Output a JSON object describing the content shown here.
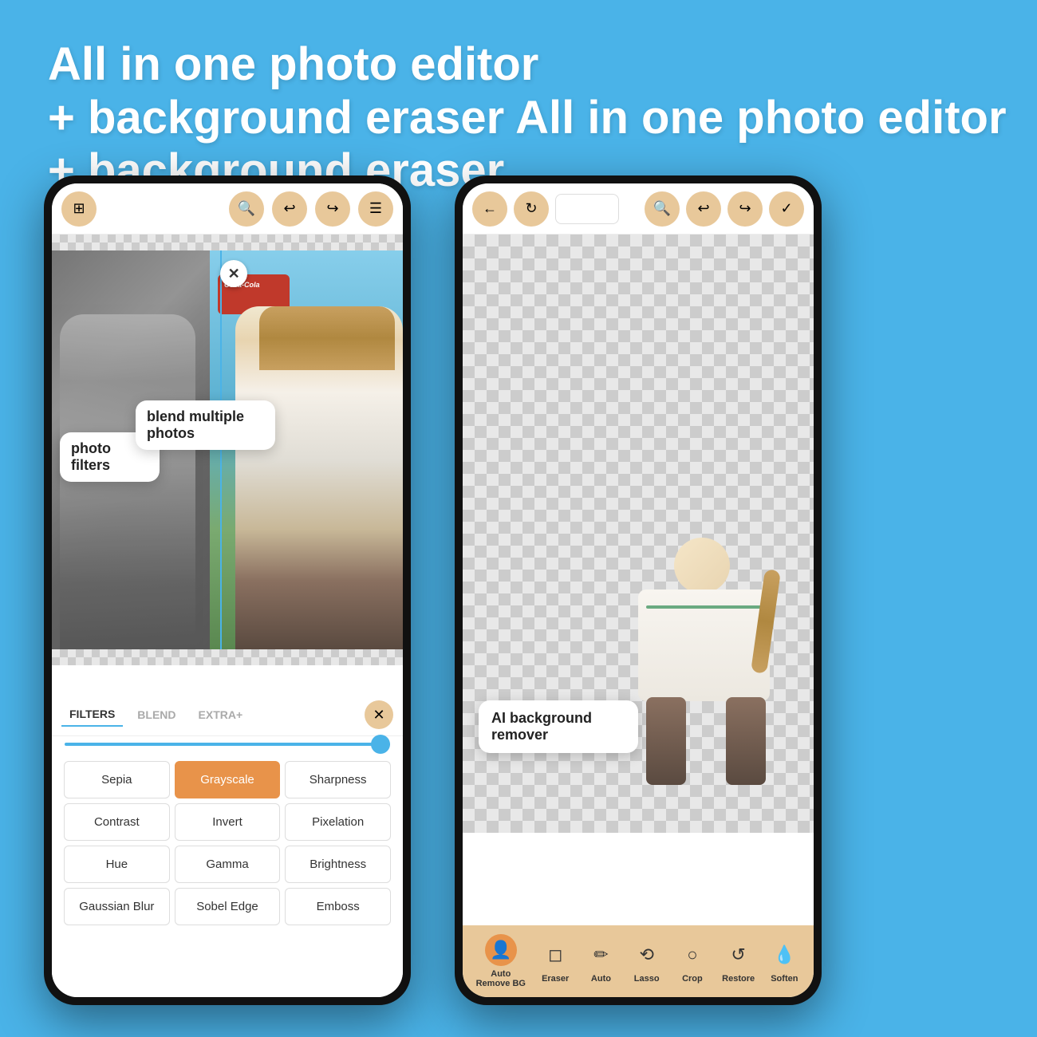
{
  "hero": {
    "title": "All in one photo editor\n+ background eraser"
  },
  "phone_left": {
    "toolbar": {
      "layers_icon": "⊕",
      "search_icon": "🔍",
      "undo_icon": "↩",
      "redo_icon": "↪",
      "menu_icon": "☰"
    },
    "callouts": {
      "filters_label": "photo\nfilters",
      "blend_label": "blend multiple\nphotos"
    },
    "tabs": {
      "filters": "FILTERS",
      "blend": "BLEND",
      "extra": "EXTRA+"
    },
    "close_icon": "×",
    "filters": [
      {
        "label": "Sepia",
        "active": false
      },
      {
        "label": "Grayscale",
        "active": true
      },
      {
        "label": "Sharpness",
        "active": false
      },
      {
        "label": "Contrast",
        "active": false
      },
      {
        "label": "Invert",
        "active": false
      },
      {
        "label": "Pixelation",
        "active": false
      },
      {
        "label": "Hue",
        "active": false
      },
      {
        "label": "Gamma",
        "active": false
      },
      {
        "label": "Brightness",
        "active": false
      },
      {
        "label": "Gaussian Blur",
        "active": false
      },
      {
        "label": "Sobel Edge",
        "active": false
      },
      {
        "label": "Emboss",
        "active": false
      }
    ]
  },
  "phone_right": {
    "toolbar": {
      "back_icon": "←",
      "refresh_icon": "↻",
      "search_icon": "🔍",
      "undo_icon": "↩",
      "redo_icon": "↪",
      "check_icon": "✓"
    },
    "callout_ai": "AI background\nremover",
    "bottom_tools": [
      {
        "icon": "👤",
        "label": "Auto\nRemove BG",
        "active": true
      },
      {
        "icon": "◻",
        "label": "Eraser",
        "active": false
      },
      {
        "icon": "✏️",
        "label": "Auto",
        "active": false
      },
      {
        "icon": "⟲",
        "label": "Lasso",
        "active": false
      },
      {
        "icon": "○",
        "label": "Crop",
        "active": false
      },
      {
        "icon": "↺",
        "label": "Restore",
        "active": false
      },
      {
        "icon": "💧",
        "label": "Soften",
        "active": false
      }
    ]
  }
}
